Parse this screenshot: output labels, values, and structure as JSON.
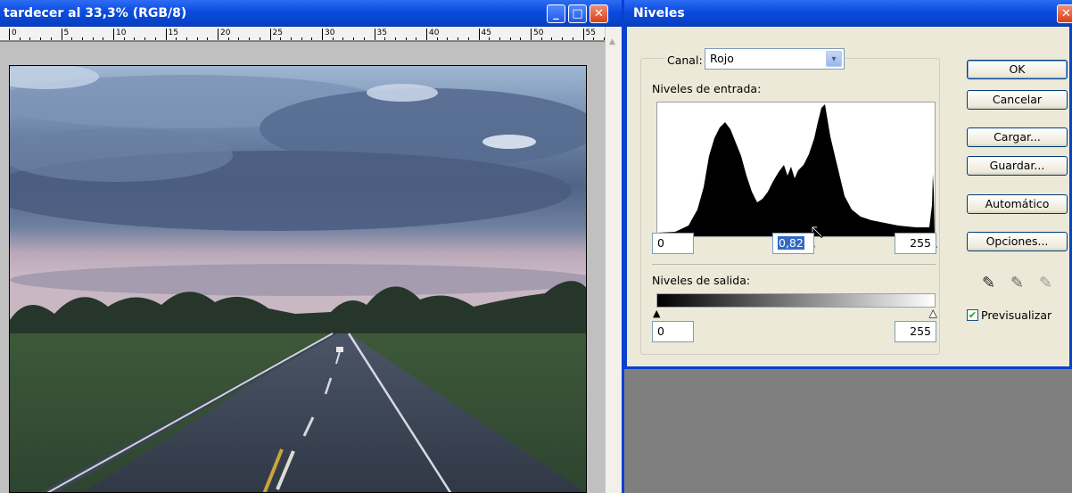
{
  "document": {
    "title": "tardecer al 33,3% (RGB/8)",
    "ruler_labels": [
      "0",
      "5",
      "10",
      "15",
      "20",
      "25",
      "30",
      "35",
      "40",
      "45",
      "50",
      "55"
    ]
  },
  "dialog": {
    "title": "Niveles",
    "channel_label": "Canal:",
    "channel_value": "Rojo",
    "input_levels_label": "Niveles de entrada:",
    "input_black": "0",
    "input_gamma": "0,82",
    "input_white": "255",
    "output_levels_label": "Niveles de salida:",
    "output_black": "0",
    "output_white": "255",
    "buttons": {
      "ok": "OK",
      "cancel": "Cancelar",
      "load": "Cargar...",
      "save": "Guardar...",
      "auto": "Automático",
      "options": "Opciones..."
    },
    "preview_label": "Previsualizar",
    "preview_checked": true
  },
  "colors": {
    "titlebar": "#0a4bdf",
    "dialog_bg": "#ece9d8",
    "canvas_bg": "#c0c0c0"
  }
}
